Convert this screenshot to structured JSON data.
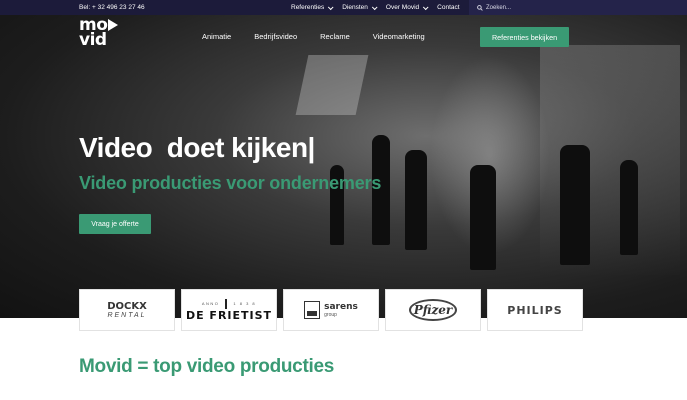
{
  "topbar": {
    "phone": "Bel: + 32 496 23 27 46",
    "menu": [
      "Referenties",
      "Diensten",
      "Over Movid",
      "Contact"
    ],
    "search_placeholder": "Zoeken..."
  },
  "brand": {
    "line1": "mo",
    "line2": "vid"
  },
  "main_nav": [
    "Animatie",
    "Bedrijfsvideo",
    "Reclame",
    "Videomarketing"
  ],
  "header_cta": "Referenties bekijken",
  "hero": {
    "headline": "Video  doet kijken|",
    "subheadline": "Video producties voor ondernemers",
    "cta": "Vraag je offerte"
  },
  "clients": {
    "dockx": {
      "name": "DOCKX",
      "sub": "RENTAL"
    },
    "frietist": {
      "top_left": "ANNO",
      "top_right": "1 8 3 8",
      "name": "DE FRIETIST"
    },
    "sarens": {
      "name": "sarens",
      "sub": "group"
    },
    "pfizer": {
      "name": "Pfizer"
    },
    "philips": {
      "name": "PHILIPS"
    }
  },
  "section": {
    "title": "Movid = top video producties"
  },
  "colors": {
    "accent": "#3a9a74",
    "topbar": "#1c1b3a"
  }
}
